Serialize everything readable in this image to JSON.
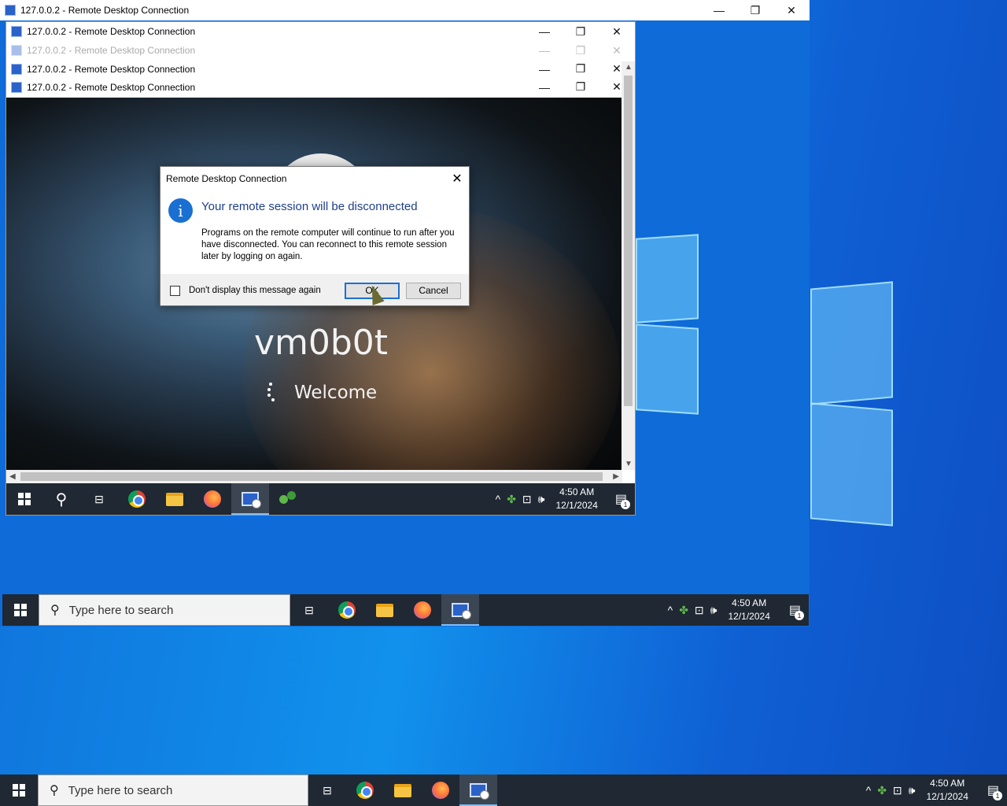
{
  "colors": {
    "taskbar": "#1f2833",
    "desktop_blue": "#0f6fd9",
    "accent": "#1a6fd2"
  },
  "outer_window": {
    "title": "127.0.0.2 - Remote Desktop Connection"
  },
  "nested_windows": [
    {
      "title": "127.0.0.2 - Remote Desktop Connection",
      "state": "active"
    },
    {
      "title": "127.0.0.2 - Remote Desktop Connection",
      "state": "inactive"
    },
    {
      "title": "127.0.0.2 - Remote Desktop Connection",
      "state": "active"
    },
    {
      "title": "127.0.0.2 - Remote Desktop Connection",
      "state": "active"
    }
  ],
  "remote_screen": {
    "username": "vm0b0t",
    "status": "Welcome"
  },
  "dialog": {
    "title": "Remote Desktop Connection",
    "heading": "Your remote session will be disconnected",
    "body": "Programs on the remote computer will continue to run after you have disconnected. You can reconnect to this remote session later by logging on again.",
    "checkbox_label": "Don't display this message again",
    "ok_label": "OK",
    "cancel_label": "Cancel",
    "icon": "info-icon"
  },
  "taskbars": {
    "inner": {
      "time": "4:50 AM",
      "date": "12/1/2024",
      "notification_count": "1"
    },
    "middle": {
      "search_placeholder": "Type here to search",
      "time": "4:50 AM",
      "date": "12/1/2024",
      "notification_count": "1"
    },
    "outer": {
      "search_placeholder": "Type here to search",
      "time": "4:50 AM",
      "date": "12/1/2024",
      "notification_count": "1"
    }
  }
}
